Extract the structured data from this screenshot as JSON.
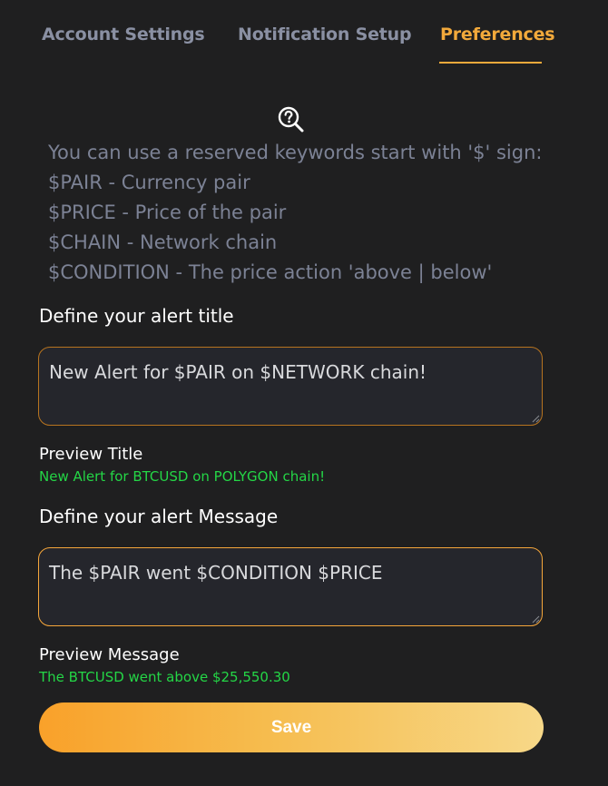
{
  "tabs": [
    {
      "label": "Account Settings"
    },
    {
      "label": "Notification Setup"
    },
    {
      "label": "Preferences",
      "active": true
    }
  ],
  "help": {
    "icon": "help-search-icon",
    "lines": [
      "You can use a reserved keywords start with '$' sign:",
      "$PAIR - Currency pair",
      "$PRICE - Price of the pair",
      "$CHAIN - Network chain",
      "$CONDITION - The price action 'above | below'"
    ]
  },
  "title_field": {
    "label": "Define your alert title",
    "value": "New Alert for $PAIR on $NETWORK chain!",
    "preview_label": "Preview Title",
    "preview_value": "New Alert for BTCUSD on POLYGON chain!"
  },
  "message_field": {
    "label": "Define your alert Message",
    "value": "The $PAIR went $CONDITION $PRICE",
    "preview_label": "Preview Message",
    "preview_value": "The BTCUSD went above $25,550.30"
  },
  "save_label": "Save",
  "colors": {
    "background": "#1f1f20",
    "accent": "#f2a93b",
    "muted_text": "#7c8295",
    "preview_green": "#24d646"
  }
}
